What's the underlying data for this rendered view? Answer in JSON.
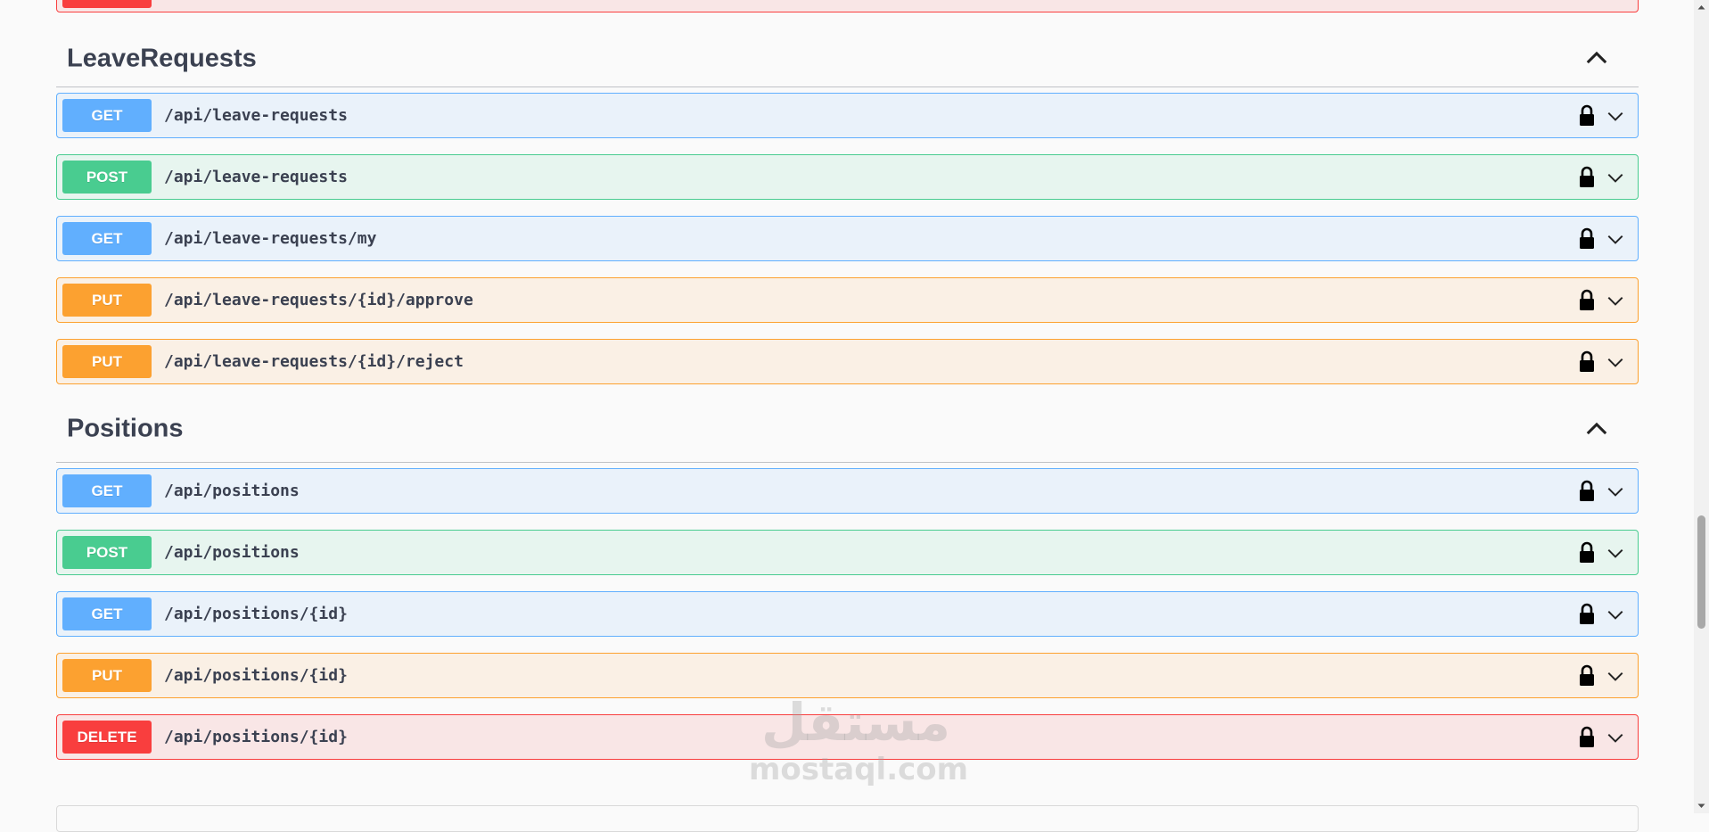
{
  "sections": [
    {
      "title": "LeaveRequests",
      "operations": [
        {
          "method": "GET",
          "path": "/api/leave-requests"
        },
        {
          "method": "POST",
          "path": "/api/leave-requests"
        },
        {
          "method": "GET",
          "path": "/api/leave-requests/my"
        },
        {
          "method": "PUT",
          "path": "/api/leave-requests/{id}/approve"
        },
        {
          "method": "PUT",
          "path": "/api/leave-requests/{id}/reject"
        }
      ]
    },
    {
      "title": "Positions",
      "operations": [
        {
          "method": "GET",
          "path": "/api/positions"
        },
        {
          "method": "POST",
          "path": "/api/positions"
        },
        {
          "method": "GET",
          "path": "/api/positions/{id}"
        },
        {
          "method": "PUT",
          "path": "/api/positions/{id}"
        },
        {
          "method": "DELETE",
          "path": "/api/positions/{id}"
        }
      ]
    }
  ],
  "watermark": {
    "arabic": "مستقل",
    "latin": "mostaql.com"
  },
  "colors": {
    "get": "#61affe",
    "post": "#49cc90",
    "put": "#fca130",
    "delete": "#f93e3e",
    "text": "#3b4151"
  },
  "icons": {
    "lock": "lock-icon",
    "expand": "chevron-down-icon",
    "collapse": "chevron-up-icon"
  }
}
